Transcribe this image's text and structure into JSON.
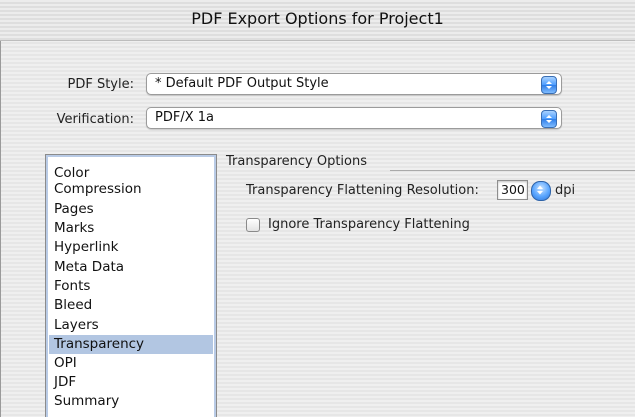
{
  "window": {
    "title": "PDF Export Options for Project1"
  },
  "form": {
    "pdf_style_label": "PDF Style:",
    "pdf_style_value": "* Default PDF Output Style",
    "verification_label": "Verification:",
    "verification_value": "PDF/X 1a"
  },
  "categories": {
    "items": [
      "Color",
      "Compression",
      "Pages",
      "Marks",
      "Hyperlink",
      "Meta Data",
      "Fonts",
      "Bleed",
      "Layers",
      "Transparency",
      "OPI",
      "JDF",
      "Summary"
    ],
    "selected": "Transparency"
  },
  "transparency": {
    "group_title": "Transparency Options",
    "resolution_label": "Transparency Flattening Resolution:",
    "resolution_value": "300",
    "resolution_unit": "dpi",
    "ignore_label": "Ignore Transparency Flattening",
    "ignore_checked": false
  },
  "colors": {
    "accent": "#4b9cff",
    "selection": "#b2c6e2"
  }
}
